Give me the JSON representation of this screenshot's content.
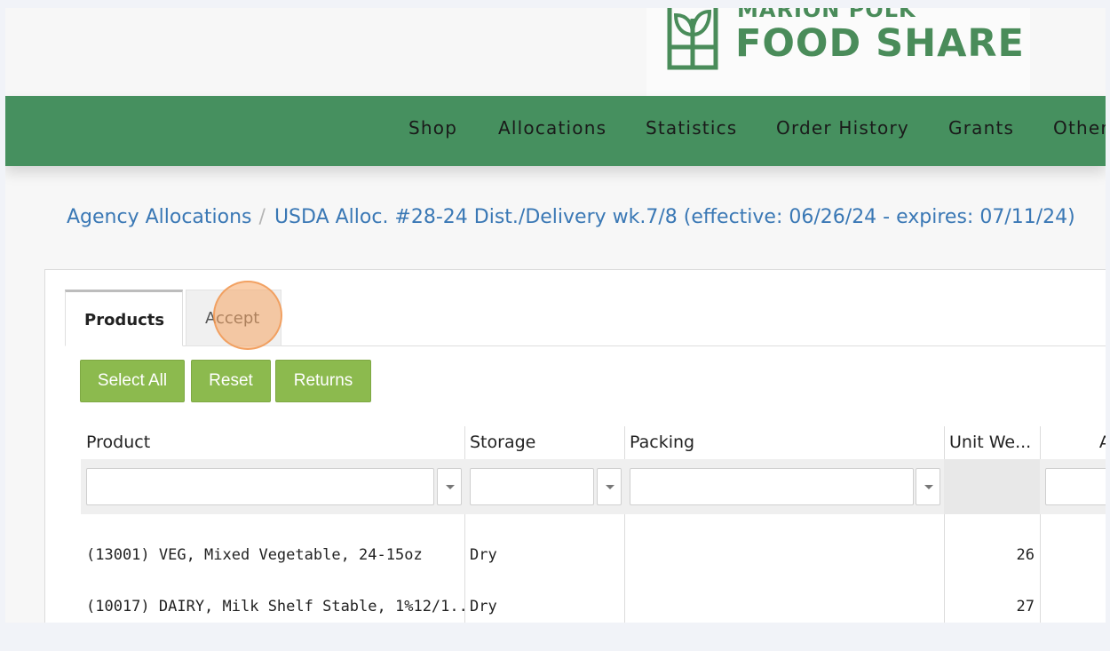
{
  "brand": {
    "name_top": "MARION POLK",
    "name_main": "FOOD SHARE",
    "color": "#4a8c5a"
  },
  "nav": {
    "items": [
      {
        "label": "Shop"
      },
      {
        "label": "Allocations"
      },
      {
        "label": "Statistics"
      },
      {
        "label": "Order History"
      },
      {
        "label": "Grants"
      },
      {
        "label": "Other"
      }
    ],
    "background": "#46905f"
  },
  "breadcrumb": {
    "parent": "Agency Allocations",
    "separator": "/",
    "current": "USDA Alloc. #28-24 Dist./Delivery wk.7/8 (effective: 06/26/24 - expires: 07/11/24)"
  },
  "tabs": [
    {
      "label": "Products",
      "active": true
    },
    {
      "label": "Accept",
      "active": false
    }
  ],
  "actions": {
    "select_all": "Select All",
    "reset": "Reset",
    "returns": "Returns",
    "color": "#8cba4e"
  },
  "table": {
    "columns": [
      "Product",
      "Storage",
      "Packing",
      "Unit We...",
      "Av"
    ],
    "rows": [
      {
        "product": "(13001) VEG, Mixed Vegetable, 24-15oz",
        "storage": "Dry",
        "packing": "",
        "unit_weight": "26"
      },
      {
        "product": "(10017) DAIRY, Milk Shelf Stable, 1%12/1...",
        "storage": "Dry",
        "packing": "",
        "unit_weight": "27"
      }
    ]
  },
  "icons": {
    "logo": "sprout-logo-icon",
    "dropdown": "chevron-down-icon"
  }
}
